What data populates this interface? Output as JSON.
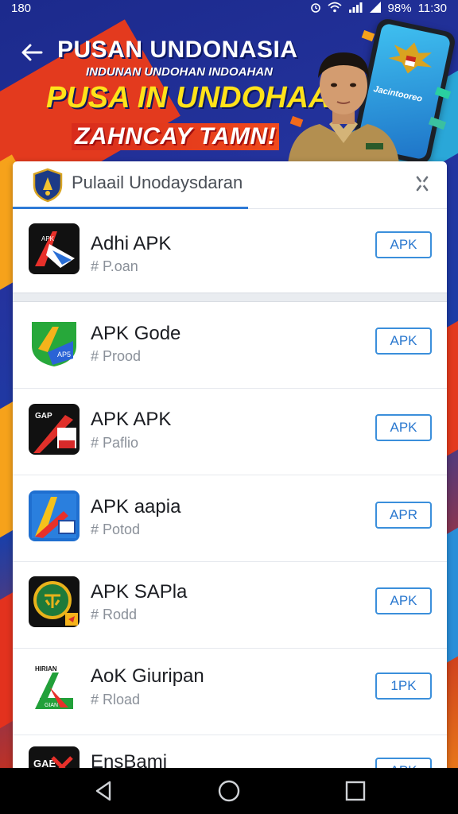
{
  "status_bar": {
    "time": "180",
    "battery": "98%",
    "clock": "11:30"
  },
  "header": {
    "headline_1": "PUSAN UNDONASIA",
    "headline_2": "INDUNAN UNDOHAN INDOAHAN",
    "headline_3": "PUSA IN UNDOHAAN",
    "headline_4": "ZAHNCAY TAMN!",
    "phone_label": "Jacintooreo"
  },
  "card": {
    "title": "Pulaail Unodaysdaran"
  },
  "apps": [
    {
      "name": "Adhi APK",
      "category": "# P.oan",
      "button": "APK"
    },
    {
      "name": "APK Gode",
      "category": "# Prood",
      "button": "APK"
    },
    {
      "name": "APK APK",
      "category": "# Paflio",
      "button": "APK"
    },
    {
      "name": "APK aapia",
      "category": "# Potod",
      "button": "APR"
    },
    {
      "name": "APK SAPla",
      "category": "# Rodd",
      "button": "APK"
    },
    {
      "name": "AoK Giuripan",
      "category": "# Rload",
      "button": "1PK"
    },
    {
      "name": "EnsBami",
      "category": "",
      "button": "APK"
    }
  ],
  "icon_text": {
    "app_1": "APK",
    "app_2": "AP5",
    "app_3": "GAP",
    "app_6_top": "HIRIAN",
    "app_6_bottom": "GIAN",
    "app_7": "GAE"
  },
  "colors": {
    "accent": "#2e7ad6",
    "button_border": "#3b8fdb",
    "headline_yellow": "#ffe21a",
    "headline_red": "#d82c1c"
  },
  "icons": {
    "back": "arrow-left-icon",
    "close": "close-icon",
    "nav_back": "triangle-back-icon",
    "nav_home": "circle-home-icon",
    "nav_recent": "square-recent-icon"
  }
}
